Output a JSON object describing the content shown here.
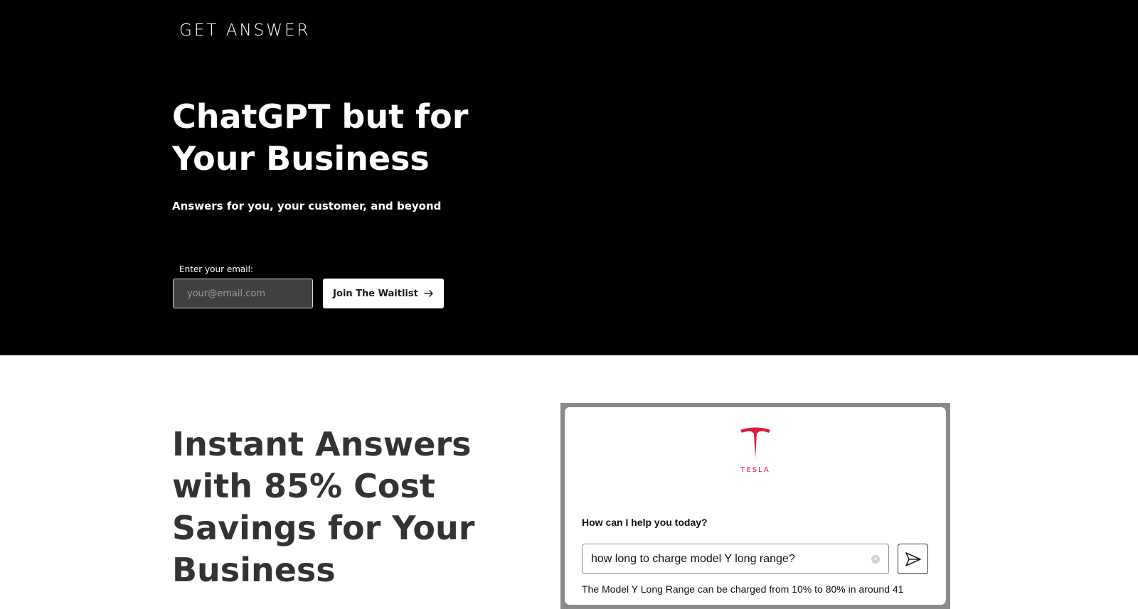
{
  "brand": {
    "logo_text": "GET ANSWER"
  },
  "hero": {
    "title_lines": [
      "ChatGPT but for",
      "Your Business"
    ],
    "subtitle": "Answers for you, your customer, and beyond",
    "email_label": "Enter your email:",
    "email_placeholder": "your@email.com",
    "cta_label": "Join The Waitlist"
  },
  "section2": {
    "title_lines": [
      "Instant Answers",
      "with 85% Cost",
      "Savings for Your",
      "Business"
    ]
  },
  "demo": {
    "brand_wordmark": "TESLA",
    "prompt": "How can I help you today?",
    "query": "how long to charge model Y long range?",
    "answer_partial": "The Model Y Long Range can be charged from 10% to 80% in around 41"
  },
  "colors": {
    "hero_bg": "#000000",
    "page_bg": "#ffffff",
    "heading_dark": "#333333",
    "tesla_red": "#e31937"
  },
  "icons": [
    "arrow-right-icon",
    "tesla-logo-icon",
    "clear-icon",
    "send-icon"
  ]
}
